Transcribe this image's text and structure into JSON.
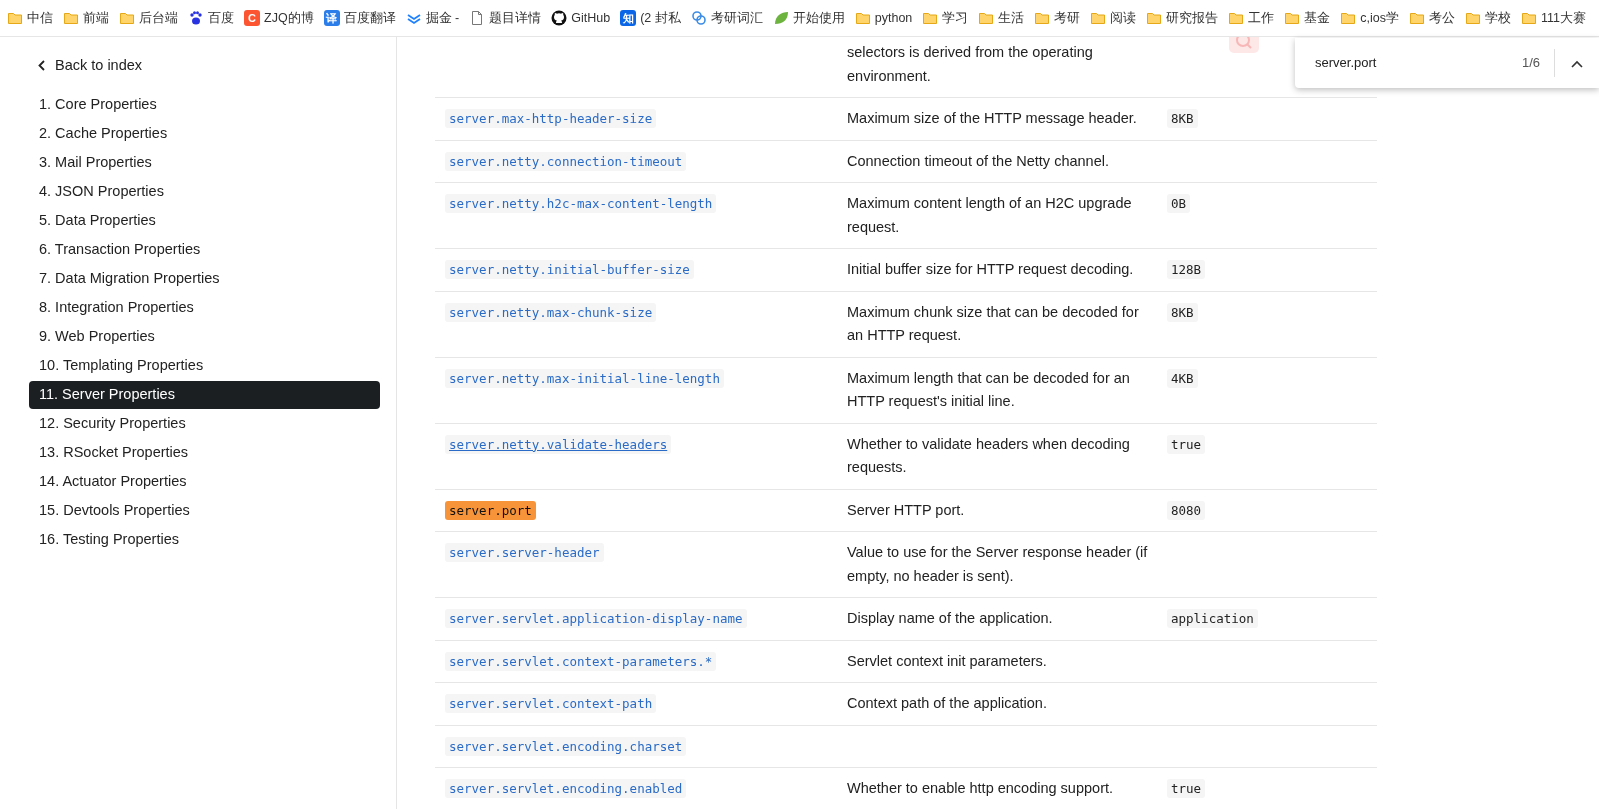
{
  "bookmarks": [
    {
      "kind": "folder",
      "label": "中信"
    },
    {
      "kind": "folder",
      "label": "前端"
    },
    {
      "kind": "folder",
      "label": "后台端"
    },
    {
      "kind": "paw",
      "label": "百度"
    },
    {
      "kind": "letter",
      "icon_text": "C",
      "color": "#fc5531",
      "label": "ZJQ的博"
    },
    {
      "kind": "letter",
      "icon_text": "译",
      "color": "#2b7de9",
      "label": "百度翻译"
    },
    {
      "kind": "chevrons",
      "label": "掘金 -"
    },
    {
      "kind": "doc",
      "label": "题目详情"
    },
    {
      "kind": "github",
      "label": "GitHub"
    },
    {
      "kind": "letter",
      "icon_text": "知",
      "color": "#0a66e6",
      "label": "(2 封私"
    },
    {
      "kind": "swirl",
      "label": "考研词汇"
    },
    {
      "kind": "leaf",
      "label": "开始使用"
    },
    {
      "kind": "folder",
      "label": "python"
    },
    {
      "kind": "folder",
      "label": "学习"
    },
    {
      "kind": "folder",
      "label": "生活"
    },
    {
      "kind": "folder",
      "label": "考研"
    },
    {
      "kind": "folder",
      "label": "阅读"
    },
    {
      "kind": "folder",
      "label": "研究报告"
    },
    {
      "kind": "folder",
      "label": "工作"
    },
    {
      "kind": "folder",
      "label": "基金"
    },
    {
      "kind": "folder",
      "label": "c,ios学"
    },
    {
      "kind": "folder",
      "label": "考公"
    },
    {
      "kind": "folder",
      "label": "学校"
    },
    {
      "kind": "folder",
      "label": "111大赛"
    }
  ],
  "sidebar": {
    "back_link": "Back to index",
    "items": [
      {
        "label": "1. Core Properties",
        "selected": false
      },
      {
        "label": "2. Cache Properties",
        "selected": false
      },
      {
        "label": "3. Mail Properties",
        "selected": false
      },
      {
        "label": "4. JSON Properties",
        "selected": false
      },
      {
        "label": "5. Data Properties",
        "selected": false
      },
      {
        "label": "6. Transaction Properties",
        "selected": false
      },
      {
        "label": "7. Data Migration Properties",
        "selected": false
      },
      {
        "label": "8. Integration Properties",
        "selected": false
      },
      {
        "label": "9. Web Properties",
        "selected": false
      },
      {
        "label": "10. Templating Properties",
        "selected": false
      },
      {
        "label": "11. Server Properties",
        "selected": true
      },
      {
        "label": "12. Security Properties",
        "selected": false
      },
      {
        "label": "13. RSocket Properties",
        "selected": false
      },
      {
        "label": "14. Actuator Properties",
        "selected": false
      },
      {
        "label": "15. Devtools Properties",
        "selected": false
      },
      {
        "label": "16. Testing Properties",
        "selected": false
      }
    ]
  },
  "table": {
    "rows": [
      {
        "description": "selectors is derived from the operating environment."
      },
      {
        "key": "server.max-http-header-size",
        "description": "Maximum size of the HTTP message header.",
        "default": "8KB",
        "highlighted": false,
        "underlined": false
      },
      {
        "key": "server.netty.connection-timeout",
        "description": "Connection timeout of the Netty channel.",
        "highlighted": false,
        "underlined": false
      },
      {
        "key": "server.netty.h2c-max-content-length",
        "description": "Maximum content length of an H2C upgrade request.",
        "default": "0B",
        "highlighted": false,
        "underlined": false
      },
      {
        "key": "server.netty.initial-buffer-size",
        "description": "Initial buffer size for HTTP request decoding.",
        "default": "128B",
        "highlighted": false,
        "underlined": false
      },
      {
        "key": "server.netty.max-chunk-size",
        "description": "Maximum chunk size that can be decoded for an HTTP request.",
        "default": "8KB",
        "highlighted": false,
        "underlined": false
      },
      {
        "key": "server.netty.max-initial-line-length",
        "description": "Maximum length that can be decoded for an HTTP request's initial line.",
        "default": "4KB",
        "highlighted": false,
        "underlined": false
      },
      {
        "key": "server.netty.validate-headers",
        "description": "Whether to validate headers when decoding requests.",
        "default": "true",
        "highlighted": false,
        "underlined": true
      },
      {
        "key": "server.port",
        "description": "Server HTTP port.",
        "default": "8080",
        "highlighted": true,
        "underlined": false
      },
      {
        "key": "server.server-header",
        "description": "Value to use for the Server response header (if empty, no header is sent).",
        "highlighted": false,
        "underlined": false
      },
      {
        "key": "server.servlet.application-display-name",
        "description": "Display name of the application.",
        "default": "application",
        "highlighted": false,
        "underlined": false
      },
      {
        "key": "server.servlet.context-parameters.*",
        "description": "Servlet context init parameters.",
        "highlighted": false,
        "underlined": false
      },
      {
        "key": "server.servlet.context-path",
        "description": "Context path of the application.",
        "highlighted": false,
        "underlined": false
      },
      {
        "key": "server.servlet.encoding.charset",
        "highlighted": false,
        "underlined": false
      },
      {
        "key": "server.servlet.encoding.enabled",
        "description": "Whether to enable http encoding support.",
        "default": "true",
        "highlighted": false,
        "underlined": false
      }
    ]
  },
  "find_bar": {
    "query": "server.port",
    "count": "1/6"
  }
}
